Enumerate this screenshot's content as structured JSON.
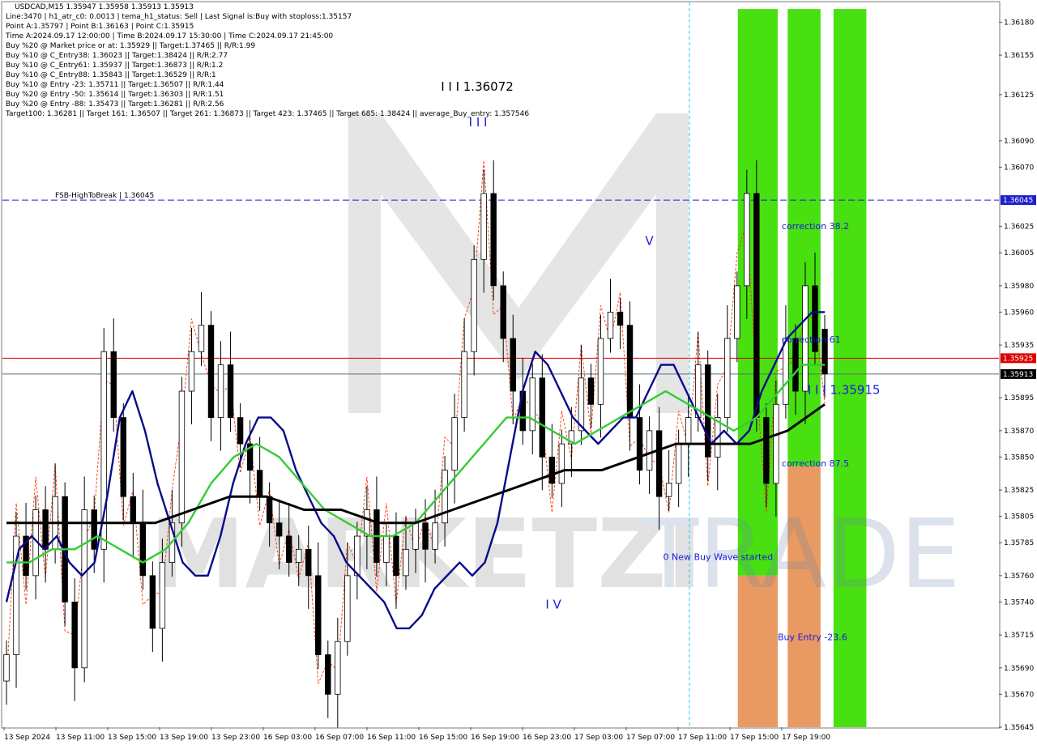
{
  "header": {
    "title": "USDCAD,M15  1.35947 1.35958 1.35913 1.35913",
    "lines": [
      "Line:3470  |  h1_atr_c0: 0.0013  |  tema_h1_status: Sell  |  Last Signal is:Buy with stoploss:1.35157",
      "Point A:1.35797  |  Point B:1.36163  |  Point C:1.35915",
      "Time A:2024.09.17 12:00:00  |  Time B:2024.09.17 15:30:00  |  Time C:2024.09.17 21:45:00",
      "Buy %20 @ Market price or at: 1.35929  ||  Target:1.37465  ||  R/R:1.99",
      "Buy %10 @ C_Entry38: 1.36023  ||  Target:1.38424  ||  R/R:2.77",
      "Buy %10 @ C_Entry61: 1.35937  ||  Target:1.36873  ||  R/R:1.2",
      "Buy %10 @ C_Entry88: 1.35843  ||  Target:1.36529  ||  R/R:1",
      "Buy %10 @ Entry -23: 1.35711  ||  Target:1.36507  ||  R/R:1.44",
      "Buy %20 @ Entry -50: 1.35614  ||  Target:1.36303  ||  R/R:1.51",
      "Buy %20 @ Entry -88: 1.35473  ||  Target:1.36281  ||  R/R:2.56",
      "Target100: 1.36281  ||  Target 161: 1.36507  ||  Target 261: 1.36873  ||  Target 423: 1.37465  ||  Target 685: 1.38424  ||  average_Buy_entry: 1.357546"
    ]
  },
  "watermark": {
    "text_left": "MARKETZI",
    "text_right": "TRADE"
  },
  "colors": {
    "bull": "#000000",
    "bear": "#000000",
    "fast_ma": "#0a0a8c",
    "mid_ma": "#33cc33",
    "slow_ma": "#000000",
    "trail": "#ff3300",
    "hline_blue": "#1f1fcc",
    "hline_red": "#dd0000",
    "hline_gray": "#5a6a7a",
    "zone_green": "#49e012",
    "zone_orange": "#e89a62",
    "label_blue": "#1a1adc",
    "cyan": "#1fd0e0"
  },
  "chart_data": {
    "type": "candlestick",
    "symbol": "USDCAD",
    "timeframe": "M15",
    "ylim": [
      1.35645,
      1.36195
    ],
    "x_ticks": [
      "13 Sep 2024",
      "13 Sep 11:00",
      "13 Sep 15:00",
      "13 Sep 19:00",
      "13 Sep 23:00",
      "16 Sep 03:00",
      "16 Sep 07:00",
      "16 Sep 11:00",
      "16 Sep 15:00",
      "16 Sep 19:00",
      "16 Sep 23:00",
      "17 Sep 03:00",
      "17 Sep 07:00",
      "17 Sep 11:00",
      "17 Sep 15:00",
      "17 Sep 19:00"
    ],
    "y_ticks": [
      "1.36180",
      "1.36155",
      "1.36125",
      "1.36090",
      "1.36070",
      "1.36025",
      "1.36005",
      "1.35980",
      "1.35960",
      "1.35935",
      "1.35895",
      "1.35870",
      "1.35850",
      "1.35825",
      "1.35805",
      "1.35785",
      "1.35760",
      "1.35740",
      "1.35715",
      "1.35690",
      "1.35670",
      "1.35645"
    ],
    "price_tags": [
      {
        "value": 1.36045,
        "text": "1.36045",
        "bg": "#1f1fcc"
      },
      {
        "value": 1.35925,
        "text": "1.35925",
        "bg": "#dd0000"
      },
      {
        "value": 1.35913,
        "text": "1.35913",
        "bg": "#000000"
      }
    ],
    "hlines": [
      {
        "value": 1.36045,
        "style": "dashed",
        "color": "#1f1fcc",
        "label": "FSB-HighToBreak  |  1.36045"
      },
      {
        "value": 1.35925,
        "style": "solid",
        "color": "#dd0000"
      },
      {
        "value": 1.35913,
        "style": "solid",
        "color": "#5a6a7a"
      }
    ],
    "zones": [
      {
        "x_start": 0.738,
        "x_end": 0.778,
        "y_from": 1.3619,
        "y_to": 1.3576,
        "color": "#49e012"
      },
      {
        "x_start": 0.738,
        "x_end": 0.778,
        "y_from": 1.3576,
        "y_to": 1.35645,
        "color": "#e89a62"
      },
      {
        "x_start": 0.788,
        "x_end": 0.821,
        "y_from": 1.3619,
        "y_to": 1.35843,
        "color": "#49e012"
      },
      {
        "x_start": 0.788,
        "x_end": 0.821,
        "y_from": 1.35843,
        "y_to": 1.35645,
        "color": "#e89a62"
      },
      {
        "x_start": 0.834,
        "x_end": 0.867,
        "y_from": 1.3619,
        "y_to": 1.35645,
        "color": "#49e012"
      }
    ],
    "annotations": [
      {
        "text": "I I I 1.36072",
        "x": 0.44,
        "y": 1.36128,
        "color": "#000000",
        "size": "large"
      },
      {
        "text": "I I I",
        "x": 0.468,
        "y": 1.36101,
        "color": "#1a1adc",
        "size": "large"
      },
      {
        "text": "V",
        "x": 0.645,
        "y": 1.36011,
        "color": "#1a1adc",
        "size": "large"
      },
      {
        "text": "I V",
        "x": 0.545,
        "y": 1.35735,
        "color": "#1a1adc",
        "size": "large"
      },
      {
        "text": "I I I 1.35915",
        "x": 0.808,
        "y": 1.35898,
        "color": "#1a1adc",
        "size": "large"
      },
      {
        "text": "correction 38.2",
        "x": 0.782,
        "y": 1.36023,
        "color": "#1a1adc",
        "size": "small"
      },
      {
        "text": "correction 61",
        "x": 0.782,
        "y": 1.35937,
        "color": "#1a1adc",
        "size": "small"
      },
      {
        "text": "correction 87.5",
        "x": 0.782,
        "y": 1.35843,
        "color": "#1a1adc",
        "size": "small"
      },
      {
        "text": "0 New Buy Wave started",
        "x": 0.663,
        "y": 1.35772,
        "color": "#1a1adc",
        "size": "small"
      },
      {
        "text": "Buy Entry -23.6",
        "x": 0.778,
        "y": 1.35711,
        "color": "#1a1adc",
        "size": "small"
      }
    ],
    "series": [
      {
        "name": "",
        "kind": "ohlc",
        "close": [
          1.357,
          1.3579,
          1.3576,
          1.3581,
          1.3578,
          1.3582,
          1.3574,
          1.3569,
          1.3581,
          1.3578,
          1.3593,
          1.3588,
          1.3582,
          1.358,
          1.3576,
          1.3572,
          1.3577,
          1.358,
          1.359,
          1.3593,
          1.3595,
          1.3588,
          1.3592,
          1.3588,
          1.3586,
          1.3584,
          1.3582,
          1.358,
          1.3579,
          1.3577,
          1.3578,
          1.3576,
          1.357,
          1.3567,
          1.3571,
          1.3576,
          1.3579,
          1.3581,
          1.3577,
          1.3579,
          1.3576,
          1.3578,
          1.358,
          1.3578,
          1.358,
          1.3584,
          1.3588,
          1.3593,
          1.36,
          1.3605,
          1.3598,
          1.3594,
          1.359,
          1.3587,
          1.3591,
          1.3585,
          1.3583,
          1.3586,
          1.3587,
          1.3591,
          1.3589,
          1.3594,
          1.3596,
          1.3595,
          1.3588,
          1.3584,
          1.3587,
          1.3582,
          1.3583,
          1.3586,
          1.3588,
          1.3592,
          1.3585,
          1.3588,
          1.3594,
          1.3598,
          1.3605,
          1.3588,
          1.3583,
          1.3589,
          1.3594,
          1.359,
          1.3598,
          1.3593,
          1.35913
        ],
        "open": [
          1.3568,
          1.357,
          1.3579,
          1.3576,
          1.3581,
          1.3578,
          1.3582,
          1.3574,
          1.3569,
          1.3581,
          1.3578,
          1.3593,
          1.3588,
          1.3582,
          1.358,
          1.3576,
          1.3572,
          1.3577,
          1.358,
          1.359,
          1.3593,
          1.3595,
          1.3588,
          1.3592,
          1.3588,
          1.3586,
          1.3584,
          1.3582,
          1.358,
          1.3579,
          1.3577,
          1.3578,
          1.3576,
          1.357,
          1.3567,
          1.3571,
          1.3576,
          1.3579,
          1.3581,
          1.3577,
          1.3579,
          1.3576,
          1.3578,
          1.358,
          1.3578,
          1.358,
          1.3584,
          1.3588,
          1.3593,
          1.36,
          1.3605,
          1.3598,
          1.3594,
          1.359,
          1.3587,
          1.3591,
          1.3585,
          1.3583,
          1.3586,
          1.3587,
          1.3591,
          1.3589,
          1.3594,
          1.3596,
          1.3595,
          1.3588,
          1.3584,
          1.3587,
          1.3582,
          1.3583,
          1.3586,
          1.3588,
          1.3592,
          1.3585,
          1.3588,
          1.3594,
          1.3598,
          1.3605,
          1.3588,
          1.3583,
          1.3589,
          1.3594,
          1.359,
          1.3598,
          1.35947
        ],
        "high_offset": 0.00018,
        "low_offset": 0.00018
      },
      {
        "name": "",
        "kind": "line",
        "color": "#0a0a8c",
        "values": [
          1.3574,
          1.3578,
          1.3579,
          1.3578,
          1.3579,
          1.3577,
          1.3576,
          1.3577,
          1.3582,
          1.3588,
          1.359,
          1.3587,
          1.3583,
          1.358,
          1.3577,
          1.3576,
          1.3576,
          1.3579,
          1.3583,
          1.3586,
          1.3588,
          1.3588,
          1.3587,
          1.3584,
          1.3582,
          1.358,
          1.3579,
          1.3577,
          1.3576,
          1.3575,
          1.3574,
          1.3572,
          1.3572,
          1.3573,
          1.3575,
          1.3576,
          1.3577,
          1.3576,
          1.3577,
          1.358,
          1.3585,
          1.359,
          1.3593,
          1.3592,
          1.359,
          1.3588,
          1.3587,
          1.3586,
          1.3587,
          1.3588,
          1.3588,
          1.359,
          1.3592,
          1.3592,
          1.359,
          1.3588,
          1.3586,
          1.3587,
          1.3586,
          1.3587,
          1.359,
          1.3592,
          1.3594,
          1.3595,
          1.3596,
          1.3596
        ]
      },
      {
        "name": "",
        "kind": "line",
        "color": "#33cc33",
        "values": [
          1.3577,
          1.3577,
          1.3578,
          1.3578,
          1.3579,
          1.3578,
          1.3577,
          1.3578,
          1.358,
          1.3583,
          1.3585,
          1.3586,
          1.3585,
          1.3583,
          1.3581,
          1.358,
          1.3579,
          1.3579,
          1.358,
          1.3582,
          1.3584,
          1.3586,
          1.3588,
          1.3588,
          1.3587,
          1.3586,
          1.3587,
          1.3588,
          1.3589,
          1.359,
          1.3589,
          1.3588,
          1.3587,
          1.3588,
          1.359,
          1.3592,
          1.3592
        ]
      },
      {
        "name": "",
        "kind": "line",
        "color": "#000000",
        "values": [
          1.358,
          1.358,
          1.358,
          1.358,
          1.358,
          1.3581,
          1.3582,
          1.3582,
          1.3581,
          1.3581,
          1.358,
          1.358,
          1.3581,
          1.3582,
          1.3583,
          1.3584,
          1.3584,
          1.3585,
          1.3586,
          1.3586,
          1.3586,
          1.3587,
          1.3589
        ]
      }
    ]
  }
}
